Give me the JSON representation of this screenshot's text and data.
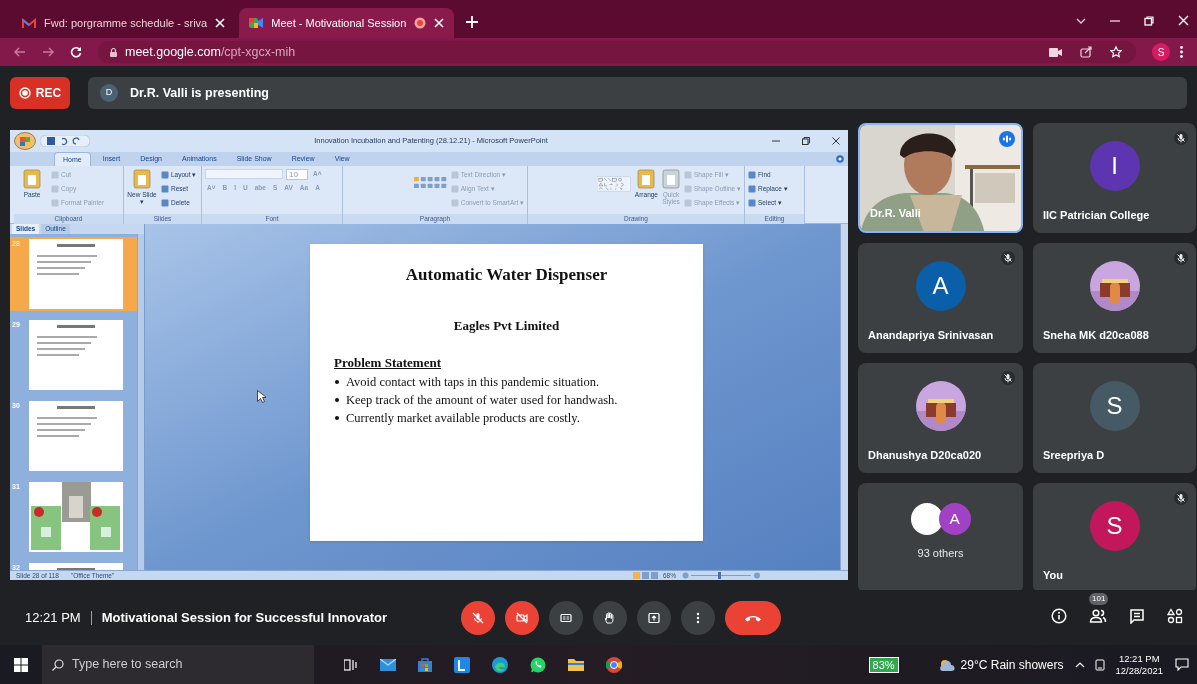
{
  "browser": {
    "tabs": [
      {
        "title": "Fwd: porgramme schedule - sriva",
        "kind": "mail",
        "selected": false,
        "recording": false
      },
      {
        "title": "Meet - Motivational Session",
        "kind": "meet",
        "selected": true,
        "recording": true
      }
    ],
    "url": {
      "host": "meet.google.com",
      "path": "/cpt-xgcx-mih"
    },
    "profile": "S"
  },
  "meet": {
    "recording_label": "REC",
    "presenter": {
      "initial": "D",
      "text": "Dr.R. Valli is presenting"
    },
    "powerpoint": {
      "title": "Innovation Incubation and Patenting (28.12.21) - Microsoft PowerPoint",
      "menu_tabs": [
        {
          "label": "Home",
          "selected": true
        },
        {
          "label": "Insert",
          "selected": false
        },
        {
          "label": "Design",
          "selected": false
        },
        {
          "label": "Animations",
          "selected": false
        },
        {
          "label": "Slide Show",
          "selected": false
        },
        {
          "label": "Review",
          "selected": false
        },
        {
          "label": "View",
          "selected": false
        }
      ],
      "ribbon": [
        {
          "label": "Clipboard",
          "items": [
            {
              "kind": "large",
              "label": "Paste",
              "disabled": false
            },
            {
              "kind": "small",
              "label": "Cut",
              "disabled": true
            },
            {
              "kind": "small",
              "label": "Copy",
              "disabled": true
            },
            {
              "kind": "small",
              "label": "Format Painter",
              "disabled": true
            }
          ]
        },
        {
          "label": "Slides",
          "items": [
            {
              "kind": "large",
              "label": "New Slide ▾",
              "disabled": false
            },
            {
              "kind": "small",
              "label": "Layout ▾",
              "disabled": false
            },
            {
              "kind": "small",
              "label": "Reset",
              "disabled": false
            },
            {
              "kind": "small",
              "label": "Delete",
              "disabled": false
            }
          ]
        },
        {
          "label": "Font",
          "items": [
            {
              "kind": "fontbox",
              "disabled": true
            },
            {
              "kind": "sizebox",
              "label": "10",
              "disabled": true
            },
            {
              "kind": "glyph",
              "label": "A˄",
              "disabled": true
            },
            {
              "kind": "glyph",
              "label": "A˅",
              "disabled": true
            },
            {
              "kind": "glyph",
              "label": "B",
              "disabled": true
            },
            {
              "kind": "glyph",
              "label": "I",
              "disabled": true
            },
            {
              "kind": "glyph",
              "label": "U",
              "disabled": true
            },
            {
              "kind": "glyph",
              "label": "abe",
              "disabled": true
            },
            {
              "kind": "glyph",
              "label": "S",
              "disabled": true
            },
            {
              "kind": "glyph",
              "label": "AV",
              "disabled": true
            },
            {
              "kind": "glyph",
              "label": "Aa",
              "disabled": true
            },
            {
              "kind": "glyph",
              "label": "A",
              "disabled": true
            }
          ]
        },
        {
          "label": "Paragraph",
          "items": [
            {
              "kind": "aligns",
              "disabled": false
            },
            {
              "kind": "small",
              "label": "Text Direction ▾",
              "disabled": true
            },
            {
              "kind": "small",
              "label": "Align Text ▾",
              "disabled": true
            },
            {
              "kind": "small",
              "label": "Convert to SmartArt ▾",
              "disabled": true
            }
          ]
        },
        {
          "label": "Drawing",
          "items": [
            {
              "kind": "shapes",
              "disabled": false
            },
            {
              "kind": "large",
              "label": "Arrange",
              "disabled": false
            },
            {
              "kind": "large",
              "label": "Quick Styles",
              "disabled": true
            },
            {
              "kind": "small",
              "label": "Shape Fill ▾",
              "disabled": true
            },
            {
              "kind": "small",
              "label": "Shape Outline ▾",
              "disabled": true
            },
            {
              "kind": "small",
              "label": "Shape Effects ▾",
              "disabled": true
            }
          ]
        },
        {
          "label": "Editing",
          "items": [
            {
              "kind": "small",
              "label": "Find",
              "disabled": false
            },
            {
              "kind": "small",
              "label": "Replace ▾",
              "disabled": false
            },
            {
              "kind": "small",
              "label": "Select ▾",
              "disabled": false
            }
          ]
        }
      ],
      "panel_tabs": [
        {
          "label": "Slides",
          "selected": true
        },
        {
          "label": "Outline",
          "selected": false
        }
      ],
      "slides": [
        {
          "number": "28",
          "selected": true,
          "kind": "text"
        },
        {
          "number": "29",
          "selected": false,
          "kind": "text"
        },
        {
          "number": "30",
          "selected": false,
          "kind": "text"
        },
        {
          "number": "31",
          "selected": false,
          "kind": "picture"
        },
        {
          "number": "32",
          "selected": false,
          "kind": "text"
        }
      ],
      "slide": {
        "title": "Automatic Water Dispenser",
        "subtitle": "Eagles Pvt Limited",
        "heading": "Problem Statement",
        "bullets": [
          "Avoid contact with taps in this pandemic situation.",
          "Keep track of the amount of water used for handwash.",
          "Currently market available products are costly."
        ]
      },
      "status": "Slide 28 of 118",
      "theme": "\"Office Theme\"",
      "zoom": "68%"
    },
    "tiles": [
      {
        "kind": "participant",
        "name": "Dr.R. Valli",
        "avatar": {
          "kind": "video"
        },
        "muted": false,
        "speaking": true
      },
      {
        "kind": "participant",
        "name": "IIC Patrician College",
        "avatar": {
          "kind": "letter",
          "letter": "I",
          "color": "#5e35b1"
        },
        "muted": true,
        "speaking": false
      },
      {
        "kind": "participant",
        "name": "Anandapriya Srinivasan",
        "avatar": {
          "kind": "letter",
          "letter": "A",
          "color": "#0b5ea8"
        },
        "muted": true,
        "speaking": false
      },
      {
        "kind": "participant",
        "name": "Sneha MK d20ca088",
        "muted": true,
        "speaking": false
      },
      {
        "kind": "participant",
        "name": "Dhanushya D20ca020",
        "muted": true,
        "speaking": false
      },
      {
        "kind": "participant",
        "name": "Sreepriya D",
        "avatar": {
          "kind": "letter",
          "letter": "S",
          "color": "#455a64"
        },
        "muted": false,
        "speaking": false
      },
      {
        "kind": "others",
        "name": "93 others",
        "avatars": [
          {
            "kind": "blank"
          },
          {
            "kind": "letter",
            "letter": "A",
            "color": "#a142c4"
          }
        ]
      },
      {
        "kind": "participant",
        "name": "You",
        "avatar": {
          "kind": "letter",
          "letter": "S",
          "color": "#c2185b"
        },
        "muted": true,
        "speaking": false
      }
    ],
    "bar": {
      "time": "12:21 PM",
      "title": "Motivational Session for Successful Innovator",
      "controls": [
        {
          "kind": "mic",
          "on": false
        },
        {
          "kind": "camera",
          "on": false
        },
        {
          "kind": "captions"
        },
        {
          "kind": "hand"
        },
        {
          "kind": "present"
        },
        {
          "kind": "more"
        },
        {
          "kind": "leave"
        }
      ],
      "participant_count": "101"
    }
  },
  "taskbar": {
    "search_placeholder": "Type here to search",
    "battery": "83%",
    "weather": "29°C Rain showers",
    "time": "12:21 PM",
    "date": "12/28/2021"
  }
}
